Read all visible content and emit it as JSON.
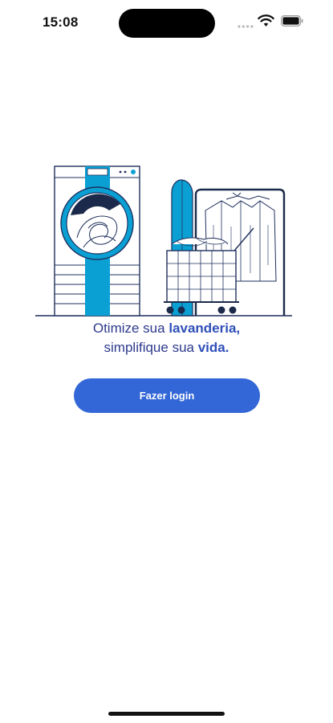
{
  "status_bar": {
    "time": "15:08",
    "icons": [
      "signal-icon",
      "wifi-icon",
      "battery-icon"
    ]
  },
  "illustration": {
    "subject": "laundry-illustration",
    "colors": {
      "accent": "#0aa0d4",
      "line": "#1e2f5c",
      "dark": "#1b2a4a"
    }
  },
  "tagline": {
    "line1_prefix": "Otimize sua ",
    "line1_accent": "lavanderia,",
    "line2_prefix": "simplifique sua ",
    "line2_accent": "vida."
  },
  "login_button": {
    "label": "Fazer login",
    "color": "#3366d6"
  }
}
